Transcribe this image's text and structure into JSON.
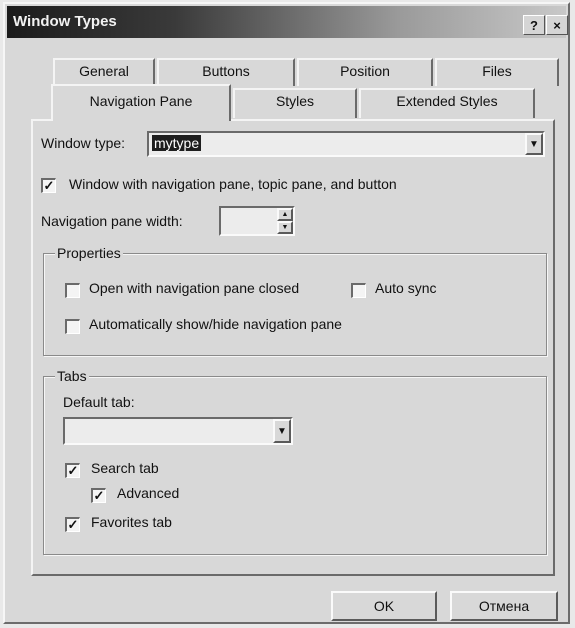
{
  "window": {
    "title": "Window Types",
    "help_label": "?",
    "close_label": "×"
  },
  "tabs_row1": [
    "General",
    "Buttons",
    "Position",
    "Files"
  ],
  "tabs_row2": [
    "Navigation Pane",
    "Styles",
    "Extended Styles"
  ],
  "form": {
    "window_type_label": "Window type:",
    "window_type_value": "mytype",
    "nav_checkbox_label": "Window with navigation pane, topic pane, and button",
    "nav_width_label": "Navigation pane width:",
    "nav_width_value": ""
  },
  "properties": {
    "legend": "Properties",
    "open_closed_label": "Open with navigation pane closed",
    "auto_sync_label": "Auto sync",
    "auto_show_hide_label": "Automatically show/hide navigation pane"
  },
  "tabs_group": {
    "legend": "Tabs",
    "default_tab_label": "Default tab:",
    "default_tab_value": "",
    "search_tab_label": "Search tab",
    "advanced_label": "Advanced",
    "favorites_tab_label": "Favorites tab"
  },
  "buttons": {
    "ok": "OK",
    "cancel": "Отмена"
  }
}
